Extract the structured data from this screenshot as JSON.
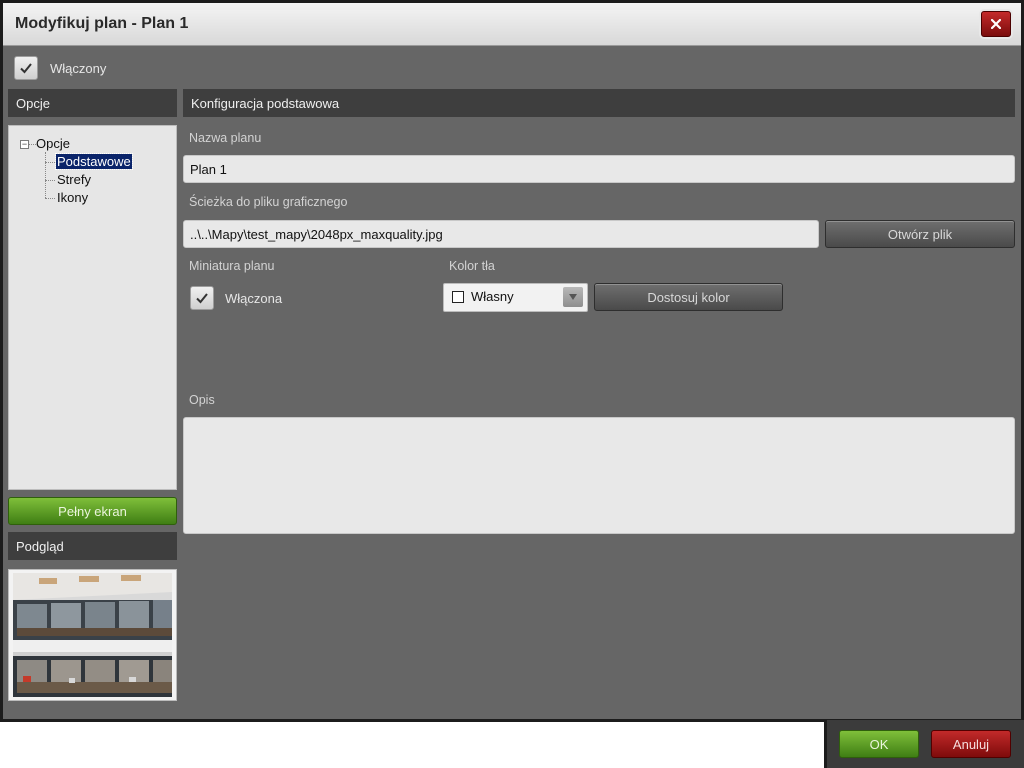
{
  "window": {
    "title": "Modyfikuj plan - Plan 1",
    "close_symbol": "×"
  },
  "enabled": {
    "label": "Włączony",
    "checked": true
  },
  "sidebar": {
    "options_header": "Opcje",
    "tree": {
      "root": "Opcje",
      "items": [
        {
          "label": "Podstawowe",
          "selected": true
        },
        {
          "label": "Strefy",
          "selected": false
        },
        {
          "label": "Ikony",
          "selected": false
        }
      ]
    },
    "fullscreen_button": "Pełny ekran",
    "preview_header": "Podgląd"
  },
  "main": {
    "section_header": "Konfiguracja podstawowa",
    "plan_name_label": "Nazwa planu",
    "plan_name_value": "Plan 1",
    "file_path_label": "Ścieżka do pliku graficznego",
    "file_path_value": "..\\..\\Mapy\\test_mapy\\2048px_maxquality.jpg",
    "open_file_button": "Otwórz plik",
    "thumbnail_label": "Miniatura planu",
    "thumbnail_checkbox_label": "Włączona",
    "thumbnail_checked": true,
    "bg_color_label": "Kolor tła",
    "bg_color_value": "Własny",
    "customize_color_button": "Dostosuj kolor",
    "description_label": "Opis",
    "description_value": ""
  },
  "footer": {
    "ok_button": "OK",
    "cancel_button": "Anuluj"
  },
  "icons": {
    "close": "close-icon",
    "checkmark": "checkmark-icon",
    "collapse": "collapse-icon",
    "dropdown": "chevron-down-icon"
  },
  "colors": {
    "window_bg": "#666666",
    "header_bg": "#3e3e3e",
    "accent_green": "#5a9e22",
    "accent_red": "#a01818",
    "selection": "#0a246a"
  }
}
